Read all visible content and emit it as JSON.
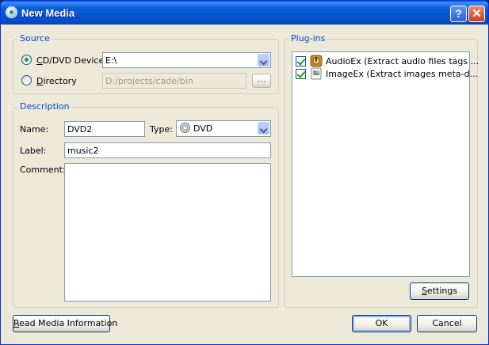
{
  "window": {
    "title": "New Media",
    "help_glyph": "?",
    "close_glyph": "✕"
  },
  "source": {
    "group_title": "Source",
    "cd_dvd": {
      "label_prefix": "C",
      "label_rest": "D/DVD Device",
      "selected": true,
      "value": "E:\\"
    },
    "directory": {
      "label_prefix": "D",
      "label_rest": "irectory",
      "selected": false,
      "value": "D:/projects/cade/bin",
      "browse_label": "..."
    }
  },
  "description": {
    "group_title": "Description",
    "name_label": "Name:",
    "name_value": "DVD2",
    "type_label": "Type:",
    "type_value": "DVD",
    "label_label": "Label:",
    "label_value": "music2",
    "comment_label": "Comment:",
    "comment_value": ""
  },
  "plugins": {
    "group_title": "Plug-ins",
    "items": [
      {
        "label": "AudioEx (Extract audio files tags ...",
        "checked": true,
        "icon": "audio-plugin-icon"
      },
      {
        "label": "ImageEx (Extract images meta-d...",
        "checked": true,
        "icon": "image-plugin-icon"
      }
    ],
    "settings_label_prefix": "S",
    "settings_label_rest": "ettings"
  },
  "footer": {
    "read_info_prefix": "R",
    "read_info_rest": "ead Media Information",
    "ok_label": "OK",
    "cancel_label": "Cancel"
  },
  "colors": {
    "titlebar": "#0a5fd9",
    "dialog_bg": "#ece9d8",
    "group_title": "#0046d5",
    "check_green": "#21a121"
  }
}
